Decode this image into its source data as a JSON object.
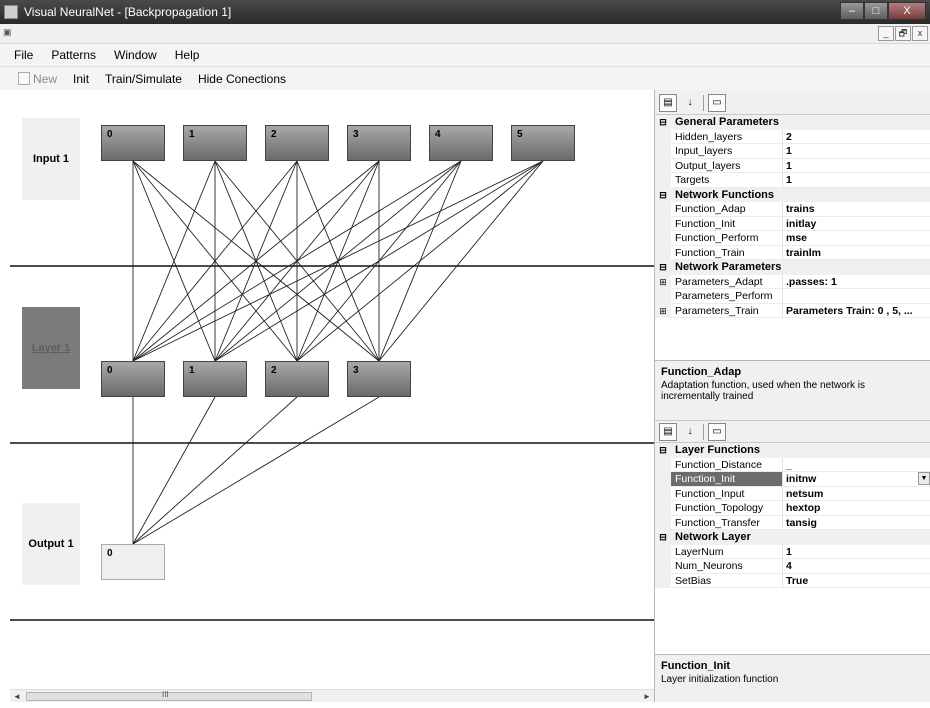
{
  "window": {
    "title": "Visual NeuralNet - [Backpropagation 1]",
    "buttons": [
      "–",
      "□",
      "X"
    ],
    "mdi_buttons": [
      "_",
      "🗗",
      "x"
    ]
  },
  "menu": [
    "File",
    "Patterns",
    "Window",
    "Help"
  ],
  "toolbar": {
    "new_label": "New",
    "init_label": "Init",
    "train_label": "Train/Simulate",
    "hide_label": "Hide Conections"
  },
  "network": {
    "layers": [
      {
        "label": "Input 1",
        "neurons": [
          "0",
          "1",
          "2",
          "3",
          "4",
          "5"
        ]
      },
      {
        "label": "Layer 1",
        "neurons": [
          "0",
          "1",
          "2",
          "3"
        ]
      },
      {
        "label": "Output 1",
        "neurons": [
          "0"
        ]
      }
    ]
  },
  "scrollbar": {
    "left": "◄",
    "right": "►",
    "grip": "III"
  },
  "network_props": {
    "groups": [
      {
        "name": "General Parameters",
        "rows": [
          {
            "name": "Hidden_layers",
            "value": "2"
          },
          {
            "name": "Input_layers",
            "value": "1"
          },
          {
            "name": "Output_layers",
            "value": "1"
          },
          {
            "name": "Targets",
            "value": "1"
          }
        ]
      },
      {
        "name": "Network Functions",
        "rows": [
          {
            "name": "Function_Adap",
            "value": "trains"
          },
          {
            "name": "Function_Init",
            "value": "initlay"
          },
          {
            "name": "Function_Perform",
            "value": "mse"
          },
          {
            "name": "Function_Train",
            "value": "trainlm"
          }
        ]
      },
      {
        "name": "Network Parameters",
        "rows": [
          {
            "name": "Parameters_Adapt",
            "value": ".passes: 1",
            "expand": "⊞"
          },
          {
            "name": "Parameters_Perform",
            "value": ""
          },
          {
            "name": "Parameters_Train",
            "value": "Parameters Train: 0 , 5, ...",
            "expand": "⊞"
          }
        ]
      }
    ],
    "desc_title": "Function_Adap",
    "desc_text": "Adaptation function, used when the network is incrementally trained"
  },
  "layer_props": {
    "groups": [
      {
        "name": "Layer Functions",
        "rows": [
          {
            "name": "Function_Distance",
            "value": "_"
          },
          {
            "name": "Function_Init",
            "value": "initnw",
            "selected": true
          },
          {
            "name": "Function_Input",
            "value": "netsum"
          },
          {
            "name": "Function_Topology",
            "value": "hextop"
          },
          {
            "name": "Function_Transfer",
            "value": "tansig"
          }
        ]
      },
      {
        "name": "Network Layer",
        "rows": [
          {
            "name": "LayerNum",
            "value": "1"
          },
          {
            "name": "Num_Neurons",
            "value": "4"
          },
          {
            "name": "SetBias",
            "value": "True"
          }
        ]
      }
    ],
    "desc_title": "Function_Init",
    "desc_text": "Layer initialization function"
  },
  "group_toggle": "⊟"
}
